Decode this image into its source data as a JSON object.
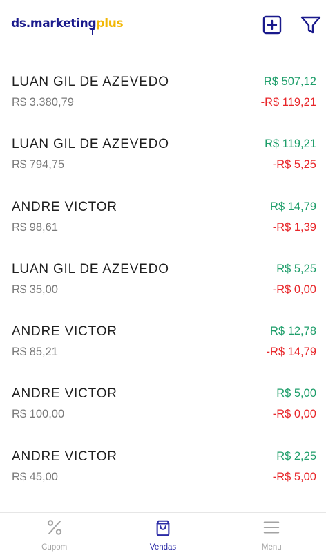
{
  "header": {
    "logo_main": "ds.marketing",
    "logo_accent": "plus",
    "add_icon": "plus-square-icon",
    "filter_icon": "filter-icon"
  },
  "colors": {
    "brand": "#1a1a8c",
    "accent": "#f2b705",
    "positive": "#1e9e6a",
    "negative": "#e8262a",
    "active_tab": "#2b2ba6",
    "inactive_tab": "#a3a3a3"
  },
  "sales": [
    {
      "name": "LUAN GIL DE AZEVEDO",
      "total": "R$ 3.380,79",
      "commission": "R$ 507,12",
      "discount": "-R$ 119,21"
    },
    {
      "name": "LUAN GIL DE AZEVEDO",
      "total": "R$ 794,75",
      "commission": "R$ 119,21",
      "discount": "-R$ 5,25"
    },
    {
      "name": "ANDRE VICTOR",
      "total": "R$ 98,61",
      "commission": "R$ 14,79",
      "discount": "-R$ 1,39"
    },
    {
      "name": "LUAN GIL DE AZEVEDO",
      "total": "R$ 35,00",
      "commission": "R$ 5,25",
      "discount": "-R$ 0,00"
    },
    {
      "name": "ANDRE VICTOR",
      "total": "R$ 85,21",
      "commission": "R$ 12,78",
      "discount": "-R$ 14,79"
    },
    {
      "name": "ANDRE VICTOR",
      "total": "R$ 100,00",
      "commission": "R$ 5,00",
      "discount": "-R$ 0,00"
    },
    {
      "name": "ANDRE VICTOR",
      "total": "R$ 45,00",
      "commission": "R$ 2,25",
      "discount": "-R$ 5,00"
    }
  ],
  "tabs": [
    {
      "label": "Cupom",
      "icon": "percent-icon",
      "active": false
    },
    {
      "label": "Vendas",
      "icon": "shopping-bag-icon",
      "active": true
    },
    {
      "label": "Menu",
      "icon": "hamburger-menu-icon",
      "active": false
    }
  ]
}
